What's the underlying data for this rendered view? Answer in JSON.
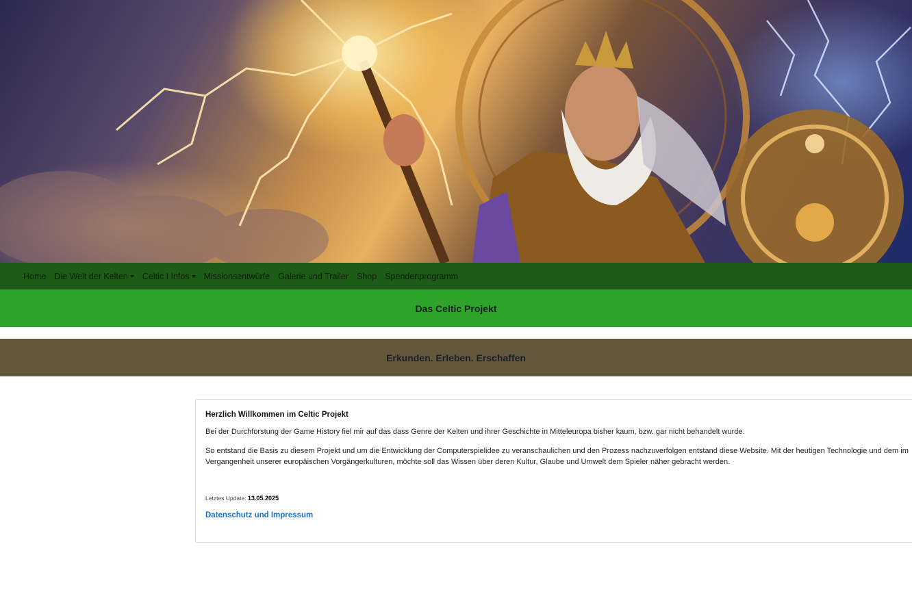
{
  "hero": {
    "image": "celtic-god-with-staff-and-lightning",
    "colors": {
      "sky_dark": "#2c2850",
      "glow": "#e8b060",
      "lightning": "#ffe9b0"
    }
  },
  "nav": {
    "items": [
      {
        "label": "Home",
        "dropdown": false
      },
      {
        "label": "Die Welt der Kelten",
        "dropdown": true
      },
      {
        "label": "Celtic I Infos",
        "dropdown": true
      },
      {
        "label": "Missionsentwürfe",
        "dropdown": false
      },
      {
        "label": "Galerie und Trailer",
        "dropdown": false
      },
      {
        "label": "Shop",
        "dropdown": false
      },
      {
        "label": "Spendenprogramm",
        "dropdown": false
      }
    ],
    "colors": {
      "background": "#1c5c17"
    }
  },
  "title_band": {
    "text": "Das Celtic Projekt",
    "color": "#2fa22c"
  },
  "tagline_band": {
    "text": "Erkunden. Erleben. Erschaffen",
    "color": "#63583c"
  },
  "card": {
    "title": "Herzlich Willkommen im Celtic Projekt",
    "paragraph1": "Bei der Durchforstung der Game History fiel mir auf das dass Genre der Kelten und ihrer Geschichte in Mitteleuropa bisher kaum, bzw. gar nicht behandelt wurde.",
    "paragraph2": "So entstand die Basis zu diesem Projekt und um die Entwicklung der Computerspielidee zu veranschaulichen und den Prozess nachzuverfolgen entstand diese Website. Mit der heutigen Technologie und dem im Vergangenheit unserer europäischen Vorgängerkulturen, möchte soll das Wissen über deren Kultur, Glaube und Umwelt dem Spieler näher gebracht werden.",
    "update_label": "Letztes Update:",
    "update_date": "13.05.2025",
    "privacy_link": "Datenschutz und Impressum",
    "link_color": "#1a74c9"
  }
}
